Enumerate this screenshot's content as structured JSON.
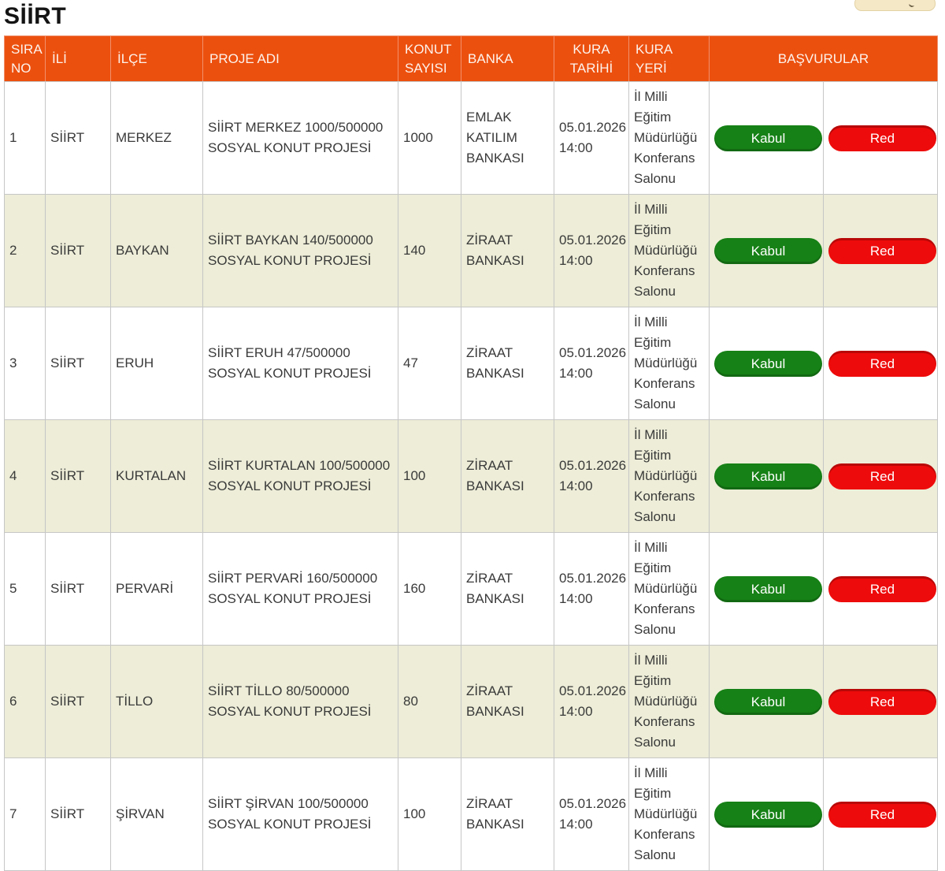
{
  "page": {
    "title": "SİİRT"
  },
  "table": {
    "headers": [
      "SIRA NO",
      "İLİ",
      "İLÇE",
      "PROJE ADI",
      "KONUT SAYISI",
      "BANKA",
      "KURA TARİHİ",
      "KURA YERİ",
      "BAŞVURULAR"
    ],
    "buttons": {
      "accept": "Kabul",
      "reject": "Red"
    },
    "rows": [
      {
        "sira_no": "1",
        "ili": "SİİRT",
        "ilce": "MERKEZ",
        "proje_adi": "SİİRT MERKEZ 1000/500000 SOSYAL KONUT PROJESİ",
        "konut_sayisi": "1000",
        "banka": "EMLAK KATILIM BANKASI",
        "kura_tarihi": "05.01.2026 14:00",
        "kura_yeri": "İl Milli Eğitim Müdürlüğü Konferans Salonu"
      },
      {
        "sira_no": "2",
        "ili": "SİİRT",
        "ilce": "BAYKAN",
        "proje_adi": "SİİRT BAYKAN 140/500000 SOSYAL KONUT PROJESİ",
        "konut_sayisi": "140",
        "banka": "ZİRAAT BANKASI",
        "kura_tarihi": "05.01.2026 14:00",
        "kura_yeri": "İl Milli Eğitim Müdürlüğü Konferans Salonu"
      },
      {
        "sira_no": "3",
        "ili": "SİİRT",
        "ilce": "ERUH",
        "proje_adi": "SİİRT ERUH 47/500000 SOSYAL KONUT PROJESİ",
        "konut_sayisi": "47",
        "banka": "ZİRAAT BANKASI",
        "kura_tarihi": "05.01.2026 14:00",
        "kura_yeri": "İl Milli Eğitim Müdürlüğü Konferans Salonu"
      },
      {
        "sira_no": "4",
        "ili": "SİİRT",
        "ilce": "KURTALAN",
        "proje_adi": "SİİRT KURTALAN 100/500000 SOSYAL KONUT PROJESİ",
        "konut_sayisi": "100",
        "banka": "ZİRAAT BANKASI",
        "kura_tarihi": "05.01.2026 14:00",
        "kura_yeri": "İl Milli Eğitim Müdürlüğü Konferans Salonu"
      },
      {
        "sira_no": "5",
        "ili": "SİİRT",
        "ilce": "PERVARİ",
        "proje_adi": "SİİRT PERVARİ 160/500000 SOSYAL KONUT PROJESİ",
        "konut_sayisi": "160",
        "banka": "ZİRAAT BANKASI",
        "kura_tarihi": "05.01.2026 14:00",
        "kura_yeri": "İl Milli Eğitim Müdürlüğü Konferans Salonu"
      },
      {
        "sira_no": "6",
        "ili": "SİİRT",
        "ilce": "TİLLO",
        "proje_adi": "SİİRT TİLLO 80/500000 SOSYAL KONUT PROJESİ",
        "konut_sayisi": "80",
        "banka": "ZİRAAT BANKASI",
        "kura_tarihi": "05.01.2026 14:00",
        "kura_yeri": "İl Milli Eğitim Müdürlüğü Konferans Salonu"
      },
      {
        "sira_no": "7",
        "ili": "SİİRT",
        "ilce": "ŞİRVAN",
        "proje_adi": "SİİRT ŞİRVAN 100/500000 SOSYAL KONUT PROJESİ",
        "konut_sayisi": "100",
        "banka": "ZİRAAT BANKASI",
        "kura_tarihi": "05.01.2026 14:00",
        "kura_yeri": "İl Milli Eğitim Müdürlüğü Konferans Salonu"
      }
    ]
  },
  "colors": {
    "header_bg": "#ec500e",
    "header_text": "#fdf2ec",
    "row_alt_bg": "#ededd8",
    "accept_green": "#168116",
    "reject_red": "#ee0b0b",
    "cell_border": "#c6c6c6"
  }
}
